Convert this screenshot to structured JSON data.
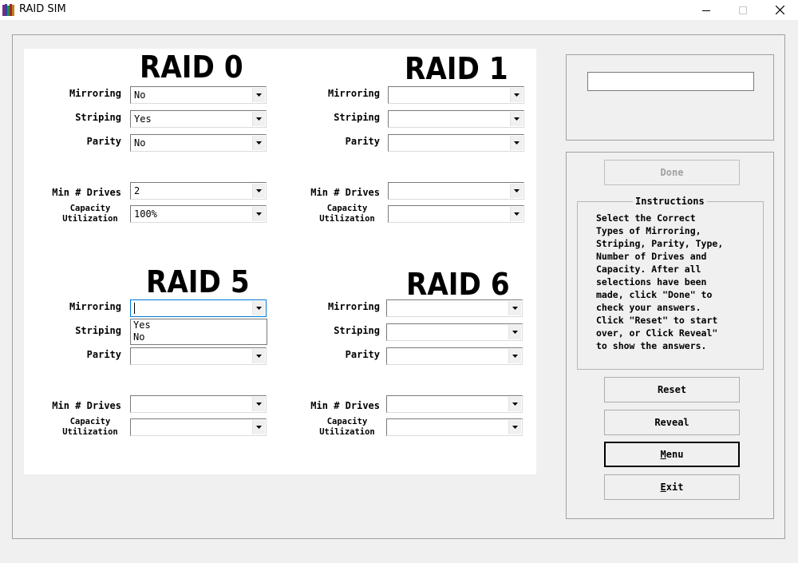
{
  "window": {
    "title": "RAID SIM"
  },
  "labels": {
    "mirroring": "Mirroring",
    "striping": "Striping",
    "parity": "Parity",
    "min_drives": "Min # Drives",
    "capacity_line1": "Capacity",
    "capacity_line2": "Utilization"
  },
  "raids": [
    {
      "title": "RAID 0",
      "mirroring": "No",
      "striping": "Yes",
      "parity": "No",
      "min_drives": "2",
      "capacity": "100%"
    },
    {
      "title": "RAID 1",
      "mirroring": "",
      "striping": "",
      "parity": "",
      "min_drives": "",
      "capacity": ""
    },
    {
      "title": "RAID 5",
      "mirroring": "",
      "striping": "",
      "parity": "",
      "min_drives": "",
      "capacity": ""
    },
    {
      "title": "RAID 6",
      "mirroring": "",
      "striping": "",
      "parity": "",
      "min_drives": "",
      "capacity": ""
    }
  ],
  "open_dropdown": {
    "options": [
      "Yes",
      "No"
    ]
  },
  "answer_box": {
    "value": ""
  },
  "buttons": {
    "done": "Done",
    "reset": "Reset",
    "reveal": "Reveal",
    "menu_rest": "enu",
    "menu_mnemonic": "M",
    "exit_mnemonic": "E",
    "exit_rest": "xit"
  },
  "instructions": {
    "title": "Instructions",
    "text": "Select the Correct\nTypes of Mirroring,\nStriping, Parity, Type,\nNumber of Drives and\nCapacity. After all\nselections have been\nmade, click \"Done\" to\ncheck your answers.\nClick \"Reset\" to start\nover, or Click Reveal\"\nto show the answers."
  },
  "colors": {
    "window_bg": "#f0f0f0",
    "panel_bg": "#ffffff",
    "disabled_text": "#a0a0a0"
  }
}
